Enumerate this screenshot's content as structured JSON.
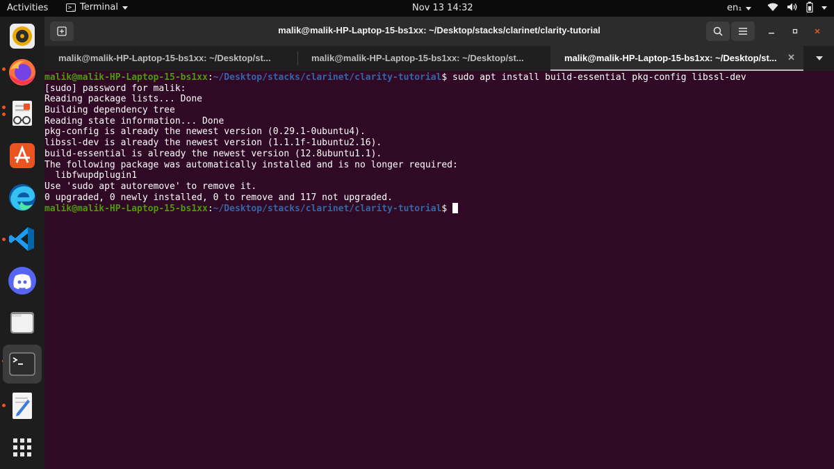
{
  "topbar": {
    "activities": "Activities",
    "app_name": "Terminal",
    "clock": "Nov 13  14:32",
    "language": "en₁"
  },
  "dock": {
    "apps": [
      {
        "name": "rhythmbox-icon",
        "running": false
      },
      {
        "name": "firefox-icon",
        "running": true
      },
      {
        "name": "document-viewer-icon",
        "running": true
      },
      {
        "name": "app-center-icon",
        "running": false
      },
      {
        "name": "edge-icon",
        "running": false
      },
      {
        "name": "vscode-icon",
        "running": true
      },
      {
        "name": "discord-icon",
        "running": false
      },
      {
        "name": "files-icon",
        "running": false
      },
      {
        "name": "terminal-icon",
        "running": true
      },
      {
        "name": "text-editor-icon",
        "running": true
      },
      {
        "name": "show-apps-icon",
        "running": false
      }
    ]
  },
  "window": {
    "title": "malik@malik-HP-Laptop-15-bs1xx: ~/Desktop/stacks/clarinet/clarity-tutorial",
    "tabs": [
      {
        "label": "malik@malik-HP-Laptop-15-bs1xx: ~/Desktop/st..."
      },
      {
        "label": "malik@malik-HP-Laptop-15-bs1xx: ~/Desktop/st..."
      },
      {
        "label": "malik@malik-HP-Laptop-15-bs1xx: ~/Desktop/st..."
      }
    ],
    "active_tab": 2
  },
  "terminal": {
    "prompt_user": "malik@malik-HP-Laptop-15-bs1xx",
    "prompt_sep": ":",
    "prompt_path": "~/Desktop/stacks/clarinet/clarity-tutorial",
    "prompt_end": "$ ",
    "command": "sudo apt install build-essential pkg-config libssl-dev",
    "output": [
      "[sudo] password for malik:",
      "Reading package lists... Done",
      "Building dependency tree",
      "Reading state information... Done",
      "pkg-config is already the newest version (0.29.1-0ubuntu4).",
      "libssl-dev is already the newest version (1.1.1f-1ubuntu2.16).",
      "build-essential is already the newest version (12.8ubuntu1.1).",
      "The following package was automatically installed and is no longer required:",
      "  libfwupdplugin1",
      "Use 'sudo apt autoremove' to remove it.",
      "0 upgraded, 0 newly installed, 0 to remove and 117 not upgraded."
    ]
  },
  "colors": {
    "terminal_bg": "#300a24",
    "prompt_user": "#4e9a06",
    "prompt_path": "#3465a4",
    "accent": "#e95420"
  }
}
